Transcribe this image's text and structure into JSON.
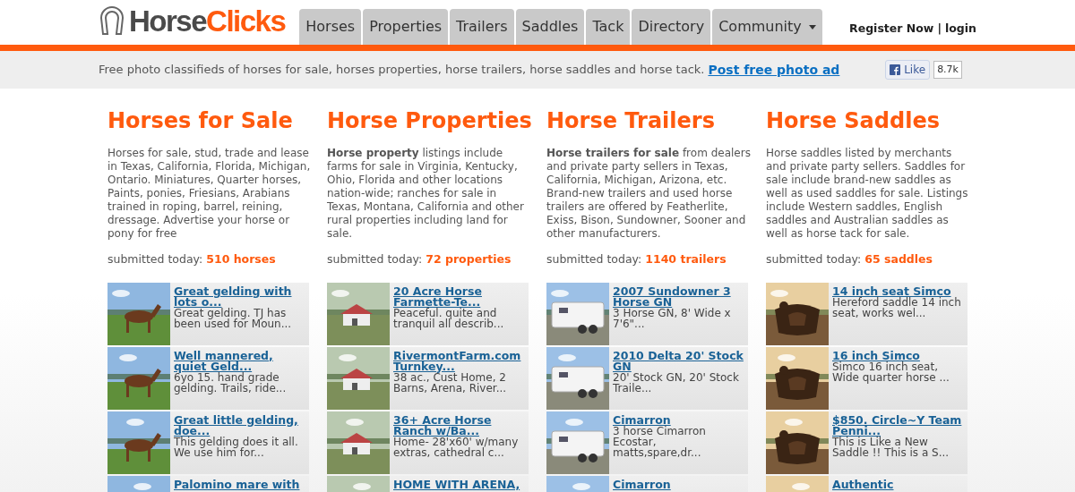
{
  "logo": {
    "text_1": "Horse",
    "text_2": "Clicks"
  },
  "nav": [
    {
      "label": "Horses",
      "dropdown": false
    },
    {
      "label": "Properties",
      "dropdown": false
    },
    {
      "label": "Trailers",
      "dropdown": false
    },
    {
      "label": "Saddles",
      "dropdown": false
    },
    {
      "label": "Tack",
      "dropdown": false
    },
    {
      "label": "Directory",
      "dropdown": false
    },
    {
      "label": "Community",
      "dropdown": true
    }
  ],
  "account": {
    "register": "Register Now",
    "separator": "|",
    "login": "login"
  },
  "tagline": {
    "text": "Free photo classifieds of horses for sale, horses properties, horse trailers, horse saddles and horse tack.",
    "link": "Post free photo ad"
  },
  "like": {
    "label": "Like",
    "count": "8.7k"
  },
  "sections": [
    {
      "kind": "horses",
      "title": "Horses for Sale",
      "description": "Horses for sale, stud, trade and lease in Texas, California, Florida, Michigan, Ontario. Miniatures, Quarter horses, Paints, ponies, Friesians, Arabians trained in roping, barrel, reining, dressage. Advertise your horse or pony for free",
      "submitted_label": "submitted today:",
      "submitted_count": "510 horses",
      "listings": [
        {
          "title": "Great gelding with lots o...",
          "summary": "Great gelding. TJ has been used for Moun..."
        },
        {
          "title": "Well mannered, quiet Geld...",
          "summary": "6yo 15. hand grade gelding. Trails, ride..."
        },
        {
          "title": "Great little gelding, doe...",
          "summary": "This gelding does it all. We use him for..."
        },
        {
          "title": "Palomino mare with"
        }
      ]
    },
    {
      "kind": "properties",
      "title": "Horse Properties",
      "description": "**Horse property** listings include farms for sale in Virginia, Kentucky, Ohio, Florida and other locations nation-wide; ranches for sale in Texas, Montana, California and other rural properties including land for sale.",
      "submitted_label": "submitted today:",
      "submitted_count": "72 properties",
      "listings": [
        {
          "title": "20 Acre Horse Farmette-Te...",
          "summary": "Peaceful. quite and tranquil all describ..."
        },
        {
          "title": "RivermontFarm.com Turnkey...",
          "summary": "38 ac., Cust Home, 2 Barns, Arena, River..."
        },
        {
          "title": "36+ Acre Horse Ranch w/Ba...",
          "summary": "Home- 28'x60' w/many extras, cathedral c..."
        },
        {
          "title": "HOME WITH ARENA,"
        }
      ]
    },
    {
      "kind": "trailers",
      "title": "Horse Trailers",
      "description": "**Horse trailers for sale** from dealers and private party sellers in Texas, California, Michigan, Arizona, etc. Brand-new trailers and used horse trailers are offered by Featherlite, Exiss, Bison, Sundowner, Sooner and other manufacturers.",
      "submitted_label": "submitted today:",
      "submitted_count": "1140 trailers",
      "listings": [
        {
          "title": "2007 Sundowner 3 Horse GN",
          "summary": "3 Horse GN, 8' Wide x 7'6\"..."
        },
        {
          "title": "2010 Delta 20' Stock GN",
          "summary": "20' Stock GN, 20' Stock Traile..."
        },
        {
          "title": "Cimarron",
          "summary": "3 horse Cimarron Ecostar, matts,spare,dr..."
        },
        {
          "title": "Cimarron"
        }
      ]
    },
    {
      "kind": "saddles",
      "title": "Horse Saddles",
      "description": "Horse saddles listed by merchants and private party sellers. Saddles for sale include brand-new saddles as well as used saddles for sale. Listings include Western saddles, English saddles and Australian saddles as well as horse tack for sale.",
      "submitted_label": "submitted today:",
      "submitted_count": "65 saddles",
      "listings": [
        {
          "title": "14 inch seat Simco",
          "summary": "Hereford saddle 14 inch seat, works wel..."
        },
        {
          "title": "16 inch Simco",
          "summary": "Simco 16 inch seat, Wide quarter horse ..."
        },
        {
          "title": "$850. Circle~Y Team Penni...",
          "summary": "This is Like a New Saddle !! This is a S..."
        },
        {
          "title": "Authentic"
        }
      ]
    }
  ]
}
